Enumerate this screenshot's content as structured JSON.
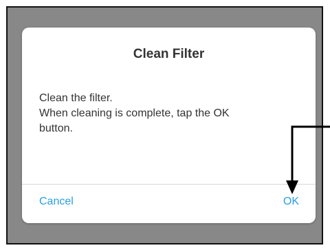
{
  "dialog": {
    "title": "Clean Filter",
    "message_lines": [
      "Clean the filter.",
      "When cleaning is complete, tap the OK",
      "button."
    ],
    "cancel_label": "Cancel",
    "ok_label": "OK"
  },
  "colors": {
    "backdrop": "#888888",
    "button_text": "#2a9fe6",
    "title_text": "#333333"
  }
}
